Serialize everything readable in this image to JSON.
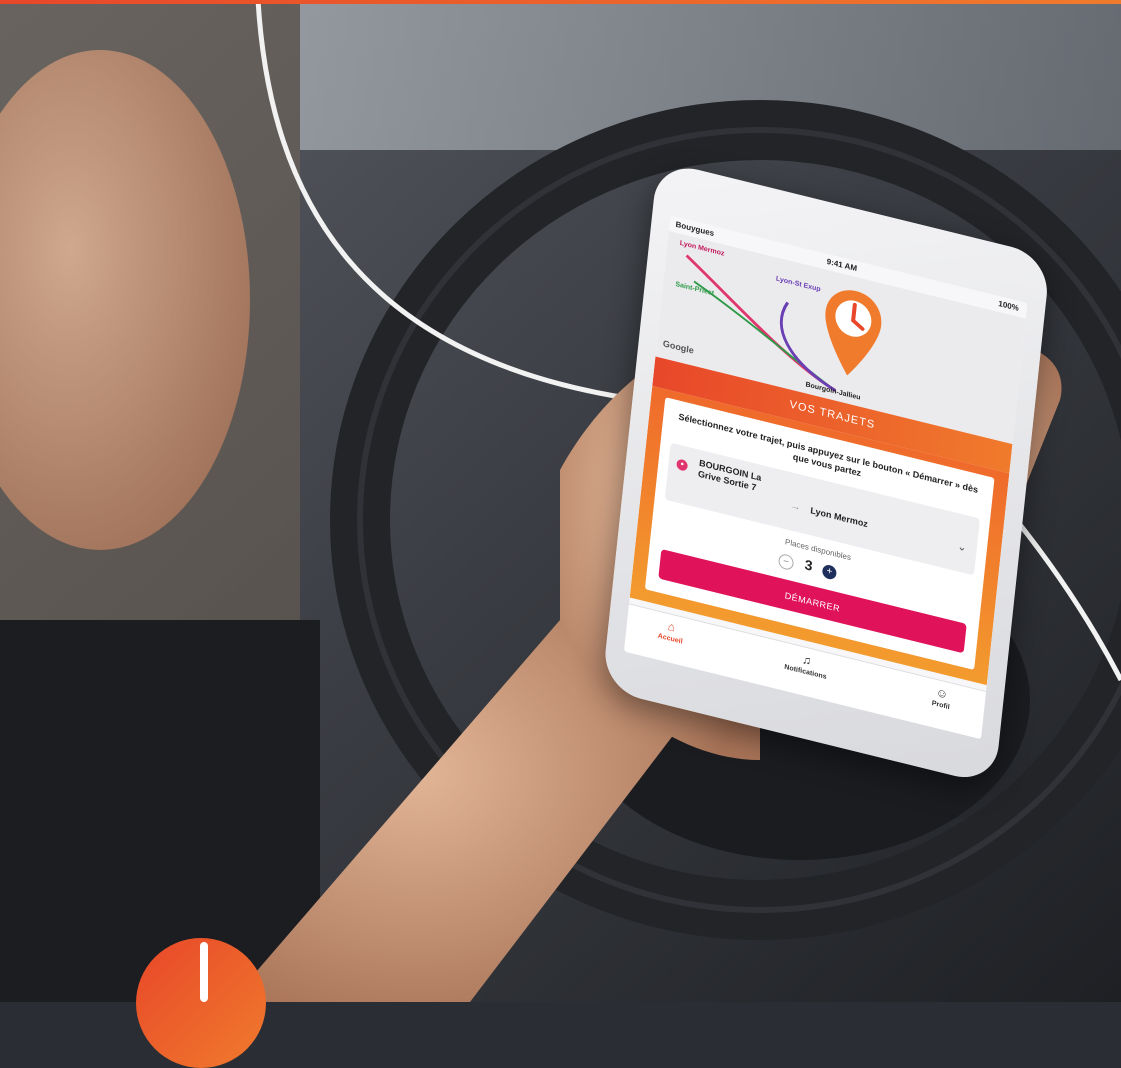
{
  "status_bar": {
    "carrier": "Bouygues",
    "time": "9:41 AM",
    "battery": "100%"
  },
  "map": {
    "labels": [
      "Lyon Mermoz",
      "Saint-Priest",
      "Lyon-St Exup",
      "Bourgoin-Jallieu"
    ],
    "provider": "Google"
  },
  "trips": {
    "header": "VOS TRAJETS",
    "instruction": "Sélectionnez votre trajet, puis appuyez sur le bouton « Démarrer » dès que vous partez",
    "trip": {
      "from": "BOURGOIN La Grive Sortie 7",
      "to": "Lyon Mermoz"
    },
    "places_label": "Places disponibles",
    "places_count": "3",
    "start_label": "DÉMARRER"
  },
  "tabbar": {
    "home": "Accueil",
    "notifications": "Notifications",
    "profile": "Profil"
  },
  "colors": {
    "brand_orange": "#e8472a",
    "brand_amber": "#f07b2c",
    "button_pink": "#e0125a",
    "route_pink": "#e0366d",
    "route_purple": "#6b3fb4"
  },
  "icons": [
    "location-pin-icon",
    "chevron-down-icon",
    "arrow-right-icon",
    "home-icon",
    "bell-icon",
    "user-icon",
    "minus-icon",
    "plus-icon"
  ]
}
